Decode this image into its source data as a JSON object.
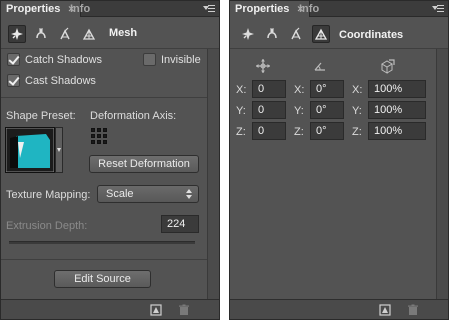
{
  "left_panel": {
    "tabs": [
      {
        "label": "Properties",
        "active": true
      },
      {
        "label": "Info",
        "active": false
      }
    ],
    "mode_label": "Mesh",
    "mode_icons": [
      "mesh-icon",
      "deformation-icon",
      "cap-icon",
      "coordinates-icon"
    ],
    "checkboxes": {
      "catch_shadows": {
        "label": "Catch Shadows",
        "checked": true
      },
      "invisible": {
        "label": "Invisible",
        "checked": false
      },
      "cast_shadows": {
        "label": "Cast Shadows",
        "checked": true
      }
    },
    "shape_preset_label": "Shape Preset:",
    "deformation_axis_label": "Deformation Axis:",
    "reset_deformation_label": "Reset Deformation",
    "texture_mapping_label": "Texture Mapping:",
    "texture_mapping_value": "Scale",
    "extrusion_depth_label": "Extrusion Depth:",
    "extrusion_depth_value": "224",
    "edit_source_label": "Edit Source",
    "footer_icons": [
      "render-icon",
      "trash-icon"
    ]
  },
  "right_panel": {
    "tabs": [
      {
        "label": "Properties",
        "active": true
      },
      {
        "label": "Info",
        "active": false
      }
    ],
    "mode_label": "Coordinates",
    "mode_icons": [
      "mesh-icon",
      "deformation-icon",
      "cap-icon",
      "coordinates-icon"
    ],
    "columns": [
      "move-icon",
      "rotate-icon",
      "scale-icon"
    ],
    "rows": [
      {
        "axis": "X:",
        "position": "0",
        "rotation_axis": "X:",
        "rotation": "0°",
        "scale_axis": "X:",
        "scale": "100%"
      },
      {
        "axis": "Y:",
        "position": "0",
        "rotation_axis": "Y:",
        "rotation": "0°",
        "scale_axis": "Y:",
        "scale": "100%"
      },
      {
        "axis": "Z:",
        "position": "0",
        "rotation_axis": "Z:",
        "rotation": "0°",
        "scale_axis": "Z:",
        "scale": "100%"
      }
    ],
    "footer_icons": [
      "render-icon",
      "trash-icon"
    ]
  },
  "colors": {
    "panel_bg": "#535353",
    "tab_bar_bg": "#3c3c3c",
    "field_bg": "#3b3b3b",
    "accent_cyan": "#1fb5c2"
  }
}
